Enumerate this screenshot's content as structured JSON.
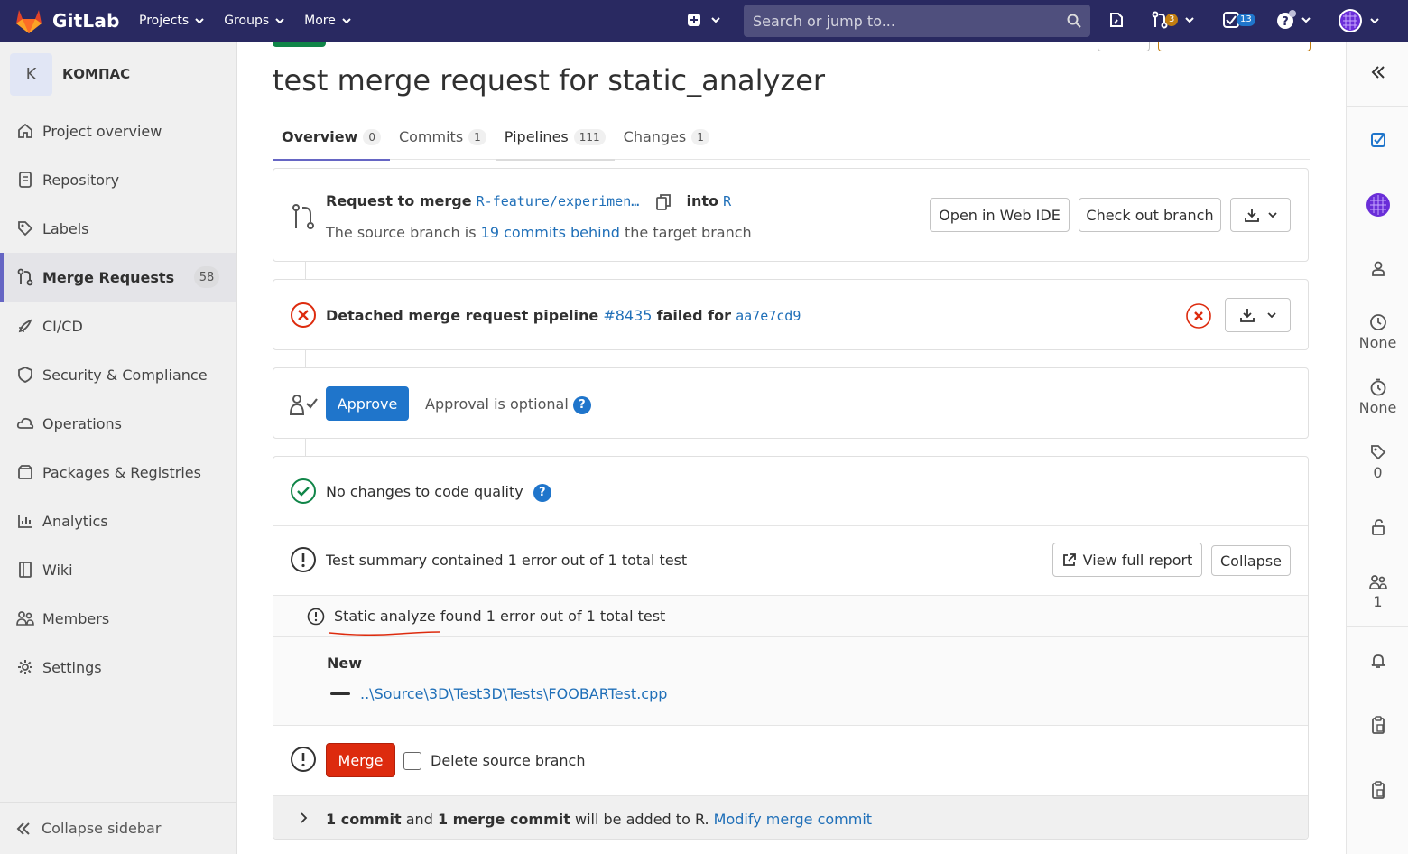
{
  "navbar": {
    "brand": "GitLab",
    "menu": [
      "Projects",
      "Groups",
      "More"
    ],
    "search_placeholder": "Search or jump to...",
    "merge_requests_count": "3",
    "todos_count": "13"
  },
  "sidebar": {
    "project_initial": "K",
    "project_name": "КОМПАС",
    "items": [
      {
        "label": "Project overview",
        "icon": "home-icon"
      },
      {
        "label": "Repository",
        "icon": "doc-icon"
      },
      {
        "label": "Labels",
        "icon": "label-icon"
      },
      {
        "label": "Merge Requests",
        "icon": "merge-request-icon",
        "count": "58"
      },
      {
        "label": "CI/CD",
        "icon": "rocket-icon"
      },
      {
        "label": "Security & Compliance",
        "icon": "shield-icon"
      },
      {
        "label": "Operations",
        "icon": "cloud-icon"
      },
      {
        "label": "Packages & Registries",
        "icon": "package-icon"
      },
      {
        "label": "Analytics",
        "icon": "chart-icon"
      },
      {
        "label": "Wiki",
        "icon": "book-icon"
      },
      {
        "label": "Members",
        "icon": "users-icon"
      },
      {
        "label": "Settings",
        "icon": "gear-icon"
      }
    ],
    "collapse_label": "Collapse sidebar"
  },
  "mr": {
    "title": "test merge request for static_analyzer",
    "tabs": [
      {
        "label": "Overview",
        "count": "0"
      },
      {
        "label": "Commits",
        "count": "1"
      },
      {
        "label": "Pipelines",
        "count": "111"
      },
      {
        "label": "Changes",
        "count": "1"
      }
    ]
  },
  "request": {
    "prefix": "Request to merge",
    "source_branch": "R-feature/experimen…",
    "into": "into",
    "target_branch": "R",
    "behind_prefix": "The source branch is",
    "behind_link": "19 commits behind",
    "behind_suffix": "the target branch",
    "open_web_ide": "Open in Web IDE",
    "checkout": "Check out branch"
  },
  "pipeline": {
    "prefix": "Detached merge request pipeline",
    "id": "#8435",
    "status": "failed for",
    "sha": "aa7e7cd9"
  },
  "approval": {
    "approve_label": "Approve",
    "optional_text": "Approval is optional"
  },
  "code_quality": {
    "text": "No changes to code quality"
  },
  "tests": {
    "summary": "Test summary contained 1 error out of 1 total test",
    "view_report": "View full report",
    "collapse": "Collapse",
    "suite_text": "Static analyze found 1 error out of 1 total test",
    "new_heading": "New",
    "file_link": "..\\Source\\3D\\Test3D\\Tests\\FOOBARTest.cpp"
  },
  "merge": {
    "merge_label": "Merge",
    "delete_source": "Delete source branch",
    "commit_count": "1 commit",
    "and": "and",
    "merge_commit": "1 merge commit",
    "added_to": "will be added to R.",
    "modify_link": "Modify merge commit"
  },
  "right_sidebar": {
    "milestone": "None",
    "time_tracking": "None",
    "labels_count": "0",
    "participants_count": "1"
  },
  "colors": {
    "navbar": "#292961",
    "link": "#1f6fb8",
    "approve": "#1f75cb",
    "merge_danger": "#dd2b0e",
    "success": "#108548",
    "error": "#dd2b0e"
  }
}
